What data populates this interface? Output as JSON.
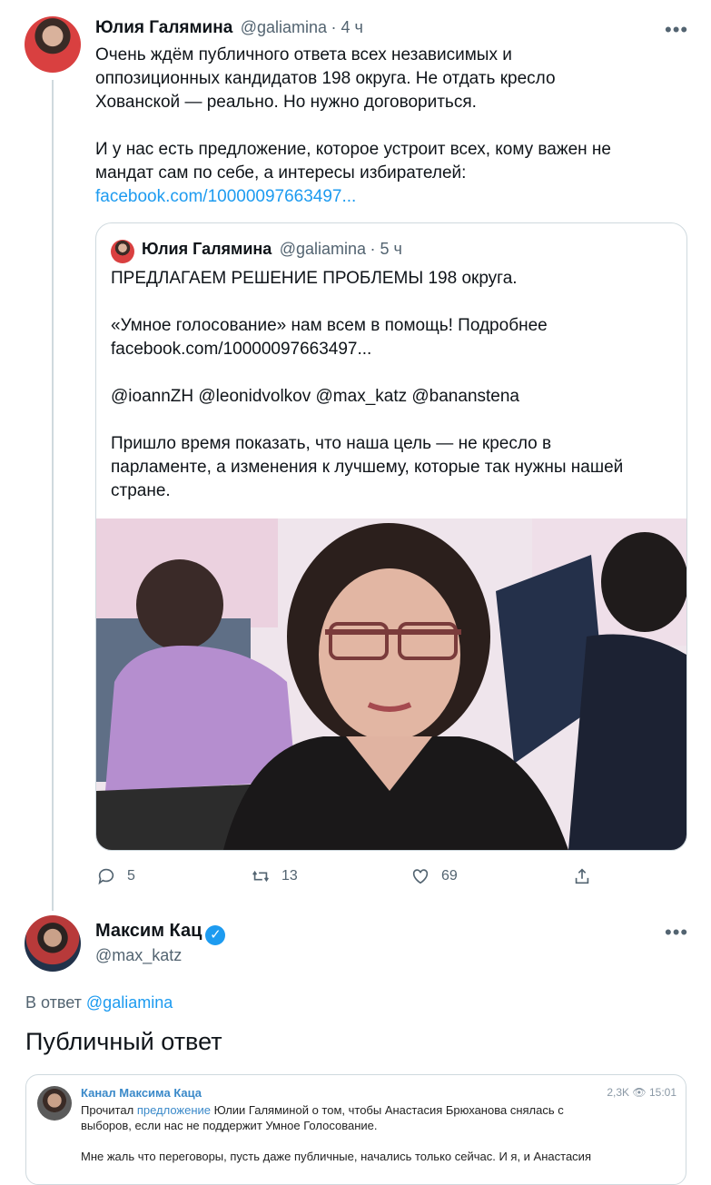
{
  "tweet1": {
    "name": "Юлия Галямина",
    "handle": "@galiamina",
    "time": "· 4 ч",
    "lines": [
      "Очень ждём публичного ответа всех независимых и",
      "оппозиционных кандидатов 198 округа. Не отдать кресло",
      "Хованской — реально. Но нужно договориться.",
      "И у нас есть предложение, которое устроит всех, кому важен не",
      "мандат сам по себе, а интересы избирателей:"
    ],
    "link": "facebook.com/10000097663497...",
    "more": "•••"
  },
  "quote": {
    "name": "Юлия Галямина",
    "handle": "@galiamina",
    "time": "· 5 ч",
    "lines": [
      "ПРЕДЛАГАЕМ РЕШЕНИЕ ПРОБЛЕМЫ 198 округа.",
      "«Умное голосование» нам всем в помощь! Подробнее",
      "facebook.com/10000097663497...",
      "@ioannZH @leonidvolkov @max_katz @bananstena",
      "Пришло время показать, что наша цель — не кресло в",
      "парламенте, а изменения к лучшему, которые так нужны нашей",
      "стране."
    ]
  },
  "actions": {
    "replies": "5",
    "retweets": "13",
    "likes": "69"
  },
  "tweet2": {
    "name": "Максим Кац",
    "handle": "@max_katz",
    "verified_mark": "✓",
    "reply_prefix": "В ответ",
    "reply_to": "@galiamina",
    "title": "Публичный ответ",
    "more": "•••"
  },
  "telegram": {
    "channel": "Канал Максима Каца",
    "views": "2,3K",
    "time": "15:01",
    "line1_a": "Прочитал",
    "line1_link": "предложение",
    "line1_b": "Юлии Галяминой о том, чтобы Анастасия Брюханова снялась с",
    "line2": "выборов, если нас не поддержит Умное Голосование.",
    "line3": "Мне жаль что переговоры, пусть даже публичные, начались только сейчас. И я, и Анастасия"
  },
  "colors": {
    "link": "#1d9bf0",
    "muted": "#536471",
    "border": "#cfd9de",
    "verified": "#1d9bf0"
  }
}
